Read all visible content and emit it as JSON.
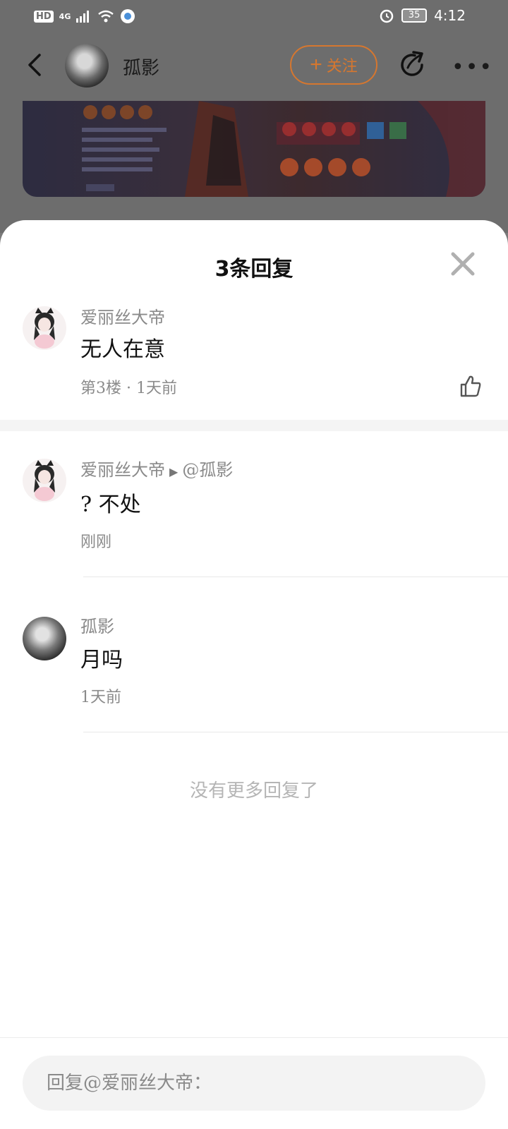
{
  "status_bar": {
    "hd": "HD",
    "network": "4G",
    "battery": "35",
    "time": "4:12"
  },
  "top_bar": {
    "username": "孤影",
    "follow_label": "关注",
    "more_label": "•••"
  },
  "sheet": {
    "title": "3条回复",
    "comments": [
      {
        "author": "爱丽丝大帝",
        "reply_to": "",
        "text": "无人在意",
        "meta": "第3楼 · 1天前"
      },
      {
        "author": "爱丽丝大帝",
        "reply_to": "@孤影",
        "text": "? 不处",
        "meta": "刚刚"
      },
      {
        "author": "孤影",
        "reply_to": "",
        "text": "月吗",
        "meta": "1天前"
      }
    ],
    "no_more": "没有更多回复了"
  },
  "reply_input": {
    "placeholder": "回复@爱丽丝大帝："
  },
  "colors": {
    "accent": "#d6772f",
    "overlay": "#6d6d6d"
  },
  "icons": [
    "back-arrow-icon",
    "plus-icon",
    "share-icon",
    "more-icon",
    "close-icon",
    "thumbs-up-icon",
    "wifi-icon",
    "alarm-icon",
    "signal-icon"
  ]
}
